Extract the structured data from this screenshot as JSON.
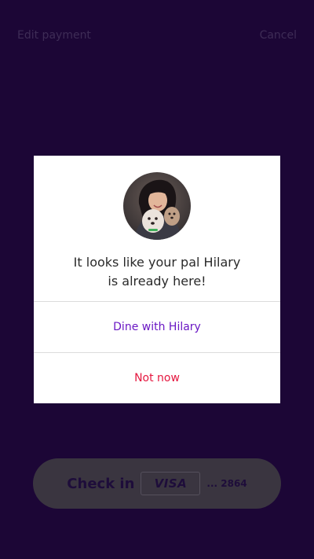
{
  "header": {
    "left_label": "Edit payment",
    "right_label": "Cancel"
  },
  "modal": {
    "message_line1": "It looks like your pal Hilary",
    "message_line2": "is already here!",
    "primary_action": "Dine with Hilary",
    "secondary_action": "Not now"
  },
  "checkin": {
    "label": "Check in",
    "card_brand": "VISA",
    "card_last": "... 2864"
  },
  "colors": {
    "background": "#1c0636",
    "primary_action": "#6a17c4",
    "secondary_action": "#e5173f"
  },
  "icons": {
    "avatar": "friend-avatar-photo"
  }
}
